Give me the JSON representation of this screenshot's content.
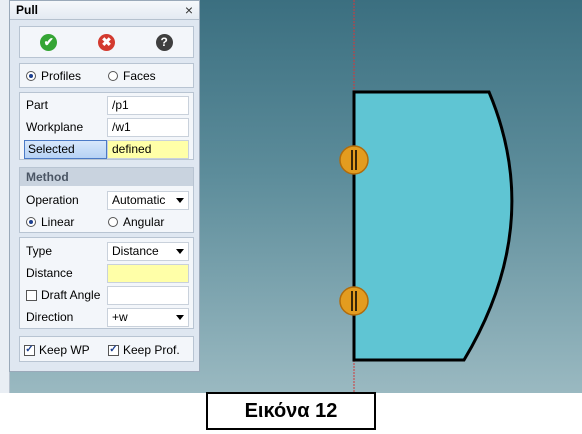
{
  "panel": {
    "title": "Pull",
    "close_glyph": "×",
    "ok_glyph": "✔",
    "cancel_glyph": "✖",
    "help_glyph": "?",
    "mode": {
      "profiles_label": "Profiles",
      "faces_label": "Faces",
      "selected": "Profiles"
    },
    "part": {
      "label": "Part",
      "value": "/p1"
    },
    "workplane": {
      "label": "Workplane",
      "value": "/w1"
    },
    "selected": {
      "label": "Selected",
      "value": "defined"
    },
    "method": {
      "heading": "Method",
      "operation_label": "Operation",
      "operation_value": "Automatic",
      "linear_label": "Linear",
      "angular_label": "Angular",
      "selected": "Linear"
    },
    "params": {
      "type_label": "Type",
      "type_value": "Distance",
      "distance_label": "Distance",
      "distance_value": "",
      "draft_angle_label": "Draft Angle",
      "draft_angle_checked": false,
      "draft_angle_value": "",
      "direction_label": "Direction",
      "direction_value": "+w"
    },
    "options": {
      "keep_wp_label": "Keep WP",
      "keep_wp_checked": true,
      "keep_prof_label": "Keep Prof.",
      "keep_prof_checked": true
    }
  },
  "caption": "Εικόνα 12",
  "colors": {
    "profile_fill": "#5fc5d3",
    "marker": "#e39c1f",
    "axis_line": "#d03a3a"
  }
}
